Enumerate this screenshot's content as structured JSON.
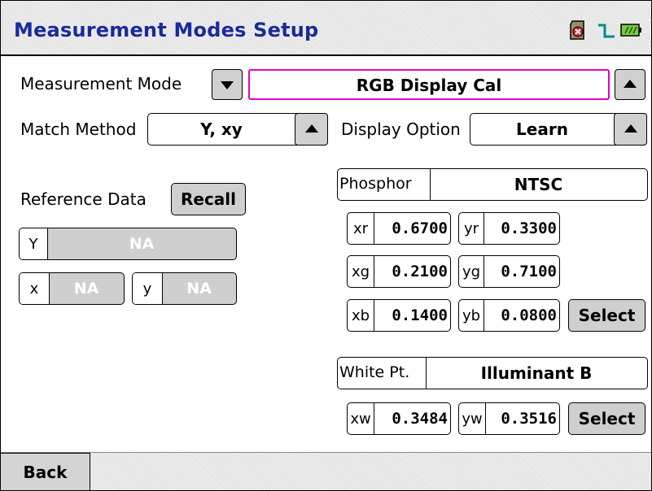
{
  "title": "Measurement Modes Setup",
  "status_icons": [
    "sd-card-error-icon",
    "signal-pulse-icon",
    "battery-icon"
  ],
  "measurement_mode": {
    "label": "Measurement Mode",
    "value": "RGB Display Cal"
  },
  "match_method": {
    "label": "Match Method",
    "value": "Y, xy"
  },
  "display_option": {
    "label": "Display Option",
    "value": "Learn"
  },
  "reference_data": {
    "label": "Reference Data",
    "recall_label": "Recall",
    "Y": {
      "tag": "Y",
      "value": "NA"
    },
    "x": {
      "tag": "x",
      "value": "NA"
    },
    "y": {
      "tag": "y",
      "value": "NA"
    }
  },
  "phosphor": {
    "label": "Phosphor",
    "value": "NTSC",
    "coords": {
      "xr": "0.6700",
      "yr": "0.3300",
      "xg": "0.2100",
      "yg": "0.7100",
      "xb": "0.1400",
      "yb": "0.0800"
    },
    "tags": {
      "xr": "xr",
      "yr": "yr",
      "xg": "xg",
      "yg": "yg",
      "xb": "xb",
      "yb": "yb"
    },
    "select_label": "Select"
  },
  "white_point": {
    "label": "White Pt.",
    "value": "Illuminant B",
    "tags": {
      "xw": "xw",
      "yw": "yw"
    },
    "coords": {
      "xw": "0.3484",
      "yw": "0.3516"
    },
    "select_label": "Select"
  },
  "footer": {
    "back_label": "Back"
  },
  "colors": {
    "title": "#1a2a9a",
    "focus_border": "#e000c8",
    "button_gray": "#cfcfcf"
  }
}
